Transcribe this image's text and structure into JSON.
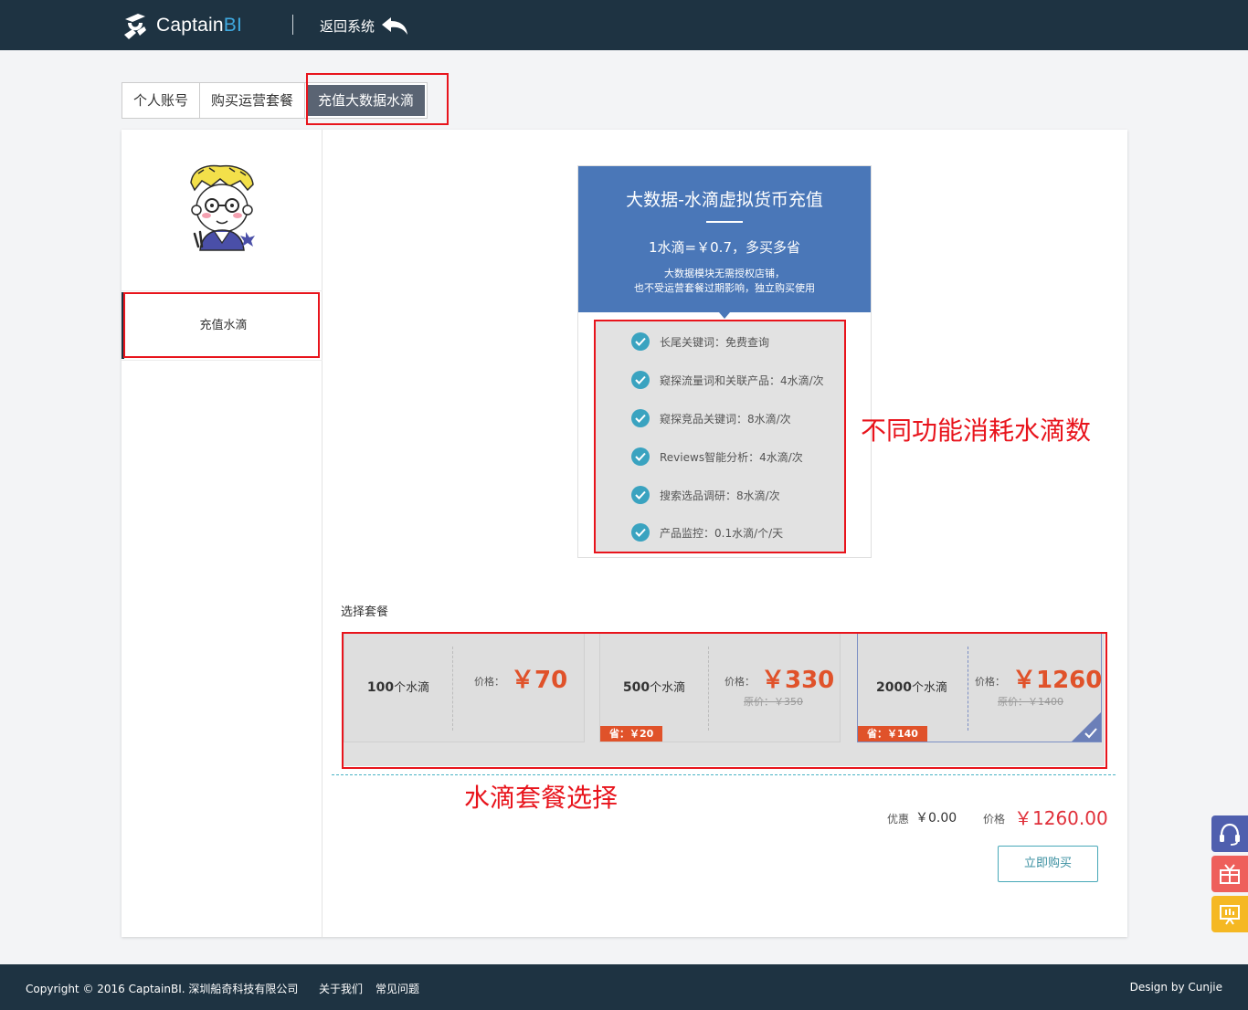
{
  "header": {
    "brand_captain": "Captain",
    "brand_bi": "BI",
    "back_label": "返回系统"
  },
  "tabs": [
    {
      "label": "个人账号",
      "active": false
    },
    {
      "label": "购买运营套餐",
      "active": false
    },
    {
      "label": "充值大数据水滴",
      "active": true
    }
  ],
  "sidebar": {
    "item_label": "充值水滴"
  },
  "info_card": {
    "title": "大数据-水滴虚拟货币充值",
    "rate": "1水滴=￥0.7，多买多省",
    "note_line1": "大数据模块无需授权店铺，",
    "note_line2": "也不受运营套餐过期影响，独立购买使用",
    "features": [
      "长尾关键词：免费查询",
      "窥探流量词和关联产品：4水滴/次",
      "窥探竞品关键词：8水滴/次",
      "Reviews智能分析：4水滴/次",
      "搜索选品调研：8水滴/次",
      "产品监控：0.1水滴/个/天"
    ]
  },
  "select_label": "选择套餐",
  "packages": [
    {
      "qty_num": "100",
      "qty_unit": "个水滴",
      "price_label": "价格：",
      "price": "￥70",
      "original": "",
      "save": "",
      "selected": false
    },
    {
      "qty_num": "500",
      "qty_unit": "个水滴",
      "price_label": "价格：",
      "price": "￥330",
      "original": "原价：￥350",
      "save": "省：￥20",
      "selected": false
    },
    {
      "qty_num": "2000",
      "qty_unit": "个水滴",
      "price_label": "价格：",
      "price": "￥1260",
      "original": "原价：￥1400",
      "save": "省：￥140",
      "selected": true
    }
  ],
  "summary": {
    "discount_label": "优惠",
    "discount_value": "￥0.00",
    "price_label": "价格",
    "price_value": "￥1260.00",
    "buy_label": "立即购买"
  },
  "annotations": {
    "features_note": "不同功能消耗水滴数",
    "packages_note": "水滴套餐选择"
  },
  "colors": {
    "header_bg": "#1e3342",
    "card_blue": "#4a77b8",
    "price_orange": "#e0522a",
    "annotation_red": "#e8141c",
    "total_red": "#e0303a"
  },
  "footer": {
    "copyright": "Copyright © 2016 CaptainBI. 深圳船奇科技有限公司",
    "about": "关于我们",
    "faq": "常见问题",
    "design": "Design by Cunjie"
  }
}
